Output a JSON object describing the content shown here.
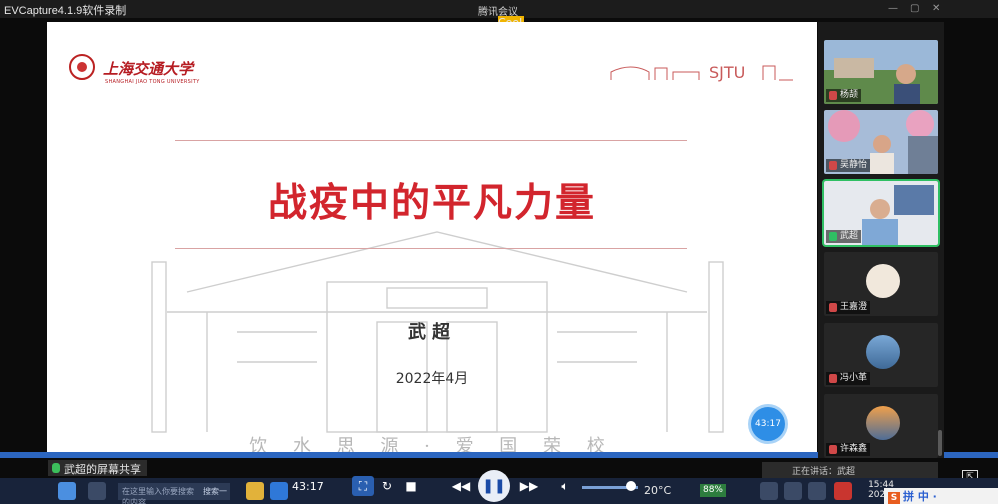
{
  "window": {
    "app_title": "EVCapture4.1.9软件录制",
    "meeting_title": "腾讯会议",
    "logo_badge": "Cool"
  },
  "slide": {
    "university_cn": "上海交通大学",
    "university_en": "SHANGHAI JIAO TONG UNIVERSITY",
    "sjtu_mark": "SJTU",
    "title": "战疫中的平凡力量",
    "presenter": "武超",
    "date": "2022年4月",
    "motto": "饮 水 思 源 · 爱 国 荣 校",
    "timer_bubble": "43:17",
    "colors": {
      "title": "#d2252d",
      "brand": "#b61c22"
    }
  },
  "share": {
    "label": "武超的屏幕共享"
  },
  "participants": [
    {
      "name": "杨颉",
      "mic": "muted"
    },
    {
      "name": "吴静怡",
      "mic": "muted"
    },
    {
      "name": "武超",
      "mic": "on",
      "active": true
    },
    {
      "name": "王嘉澄",
      "mic": "muted"
    },
    {
      "name": "冯小革",
      "mic": "muted"
    },
    {
      "name": "许森鑫",
      "mic": "muted"
    }
  ],
  "status": {
    "speaking": "正在讲话：武超"
  },
  "taskbar": {
    "search_placeholder": "在这里输入你要搜索的内容",
    "search_button": "搜索一下",
    "temperature": "20°C",
    "battery": "88%",
    "clock_time": "15:44",
    "clock_date": "2022/"
  },
  "player": {
    "elapsed": "43:17"
  },
  "ime": {
    "label": "拼 中 ·"
  }
}
